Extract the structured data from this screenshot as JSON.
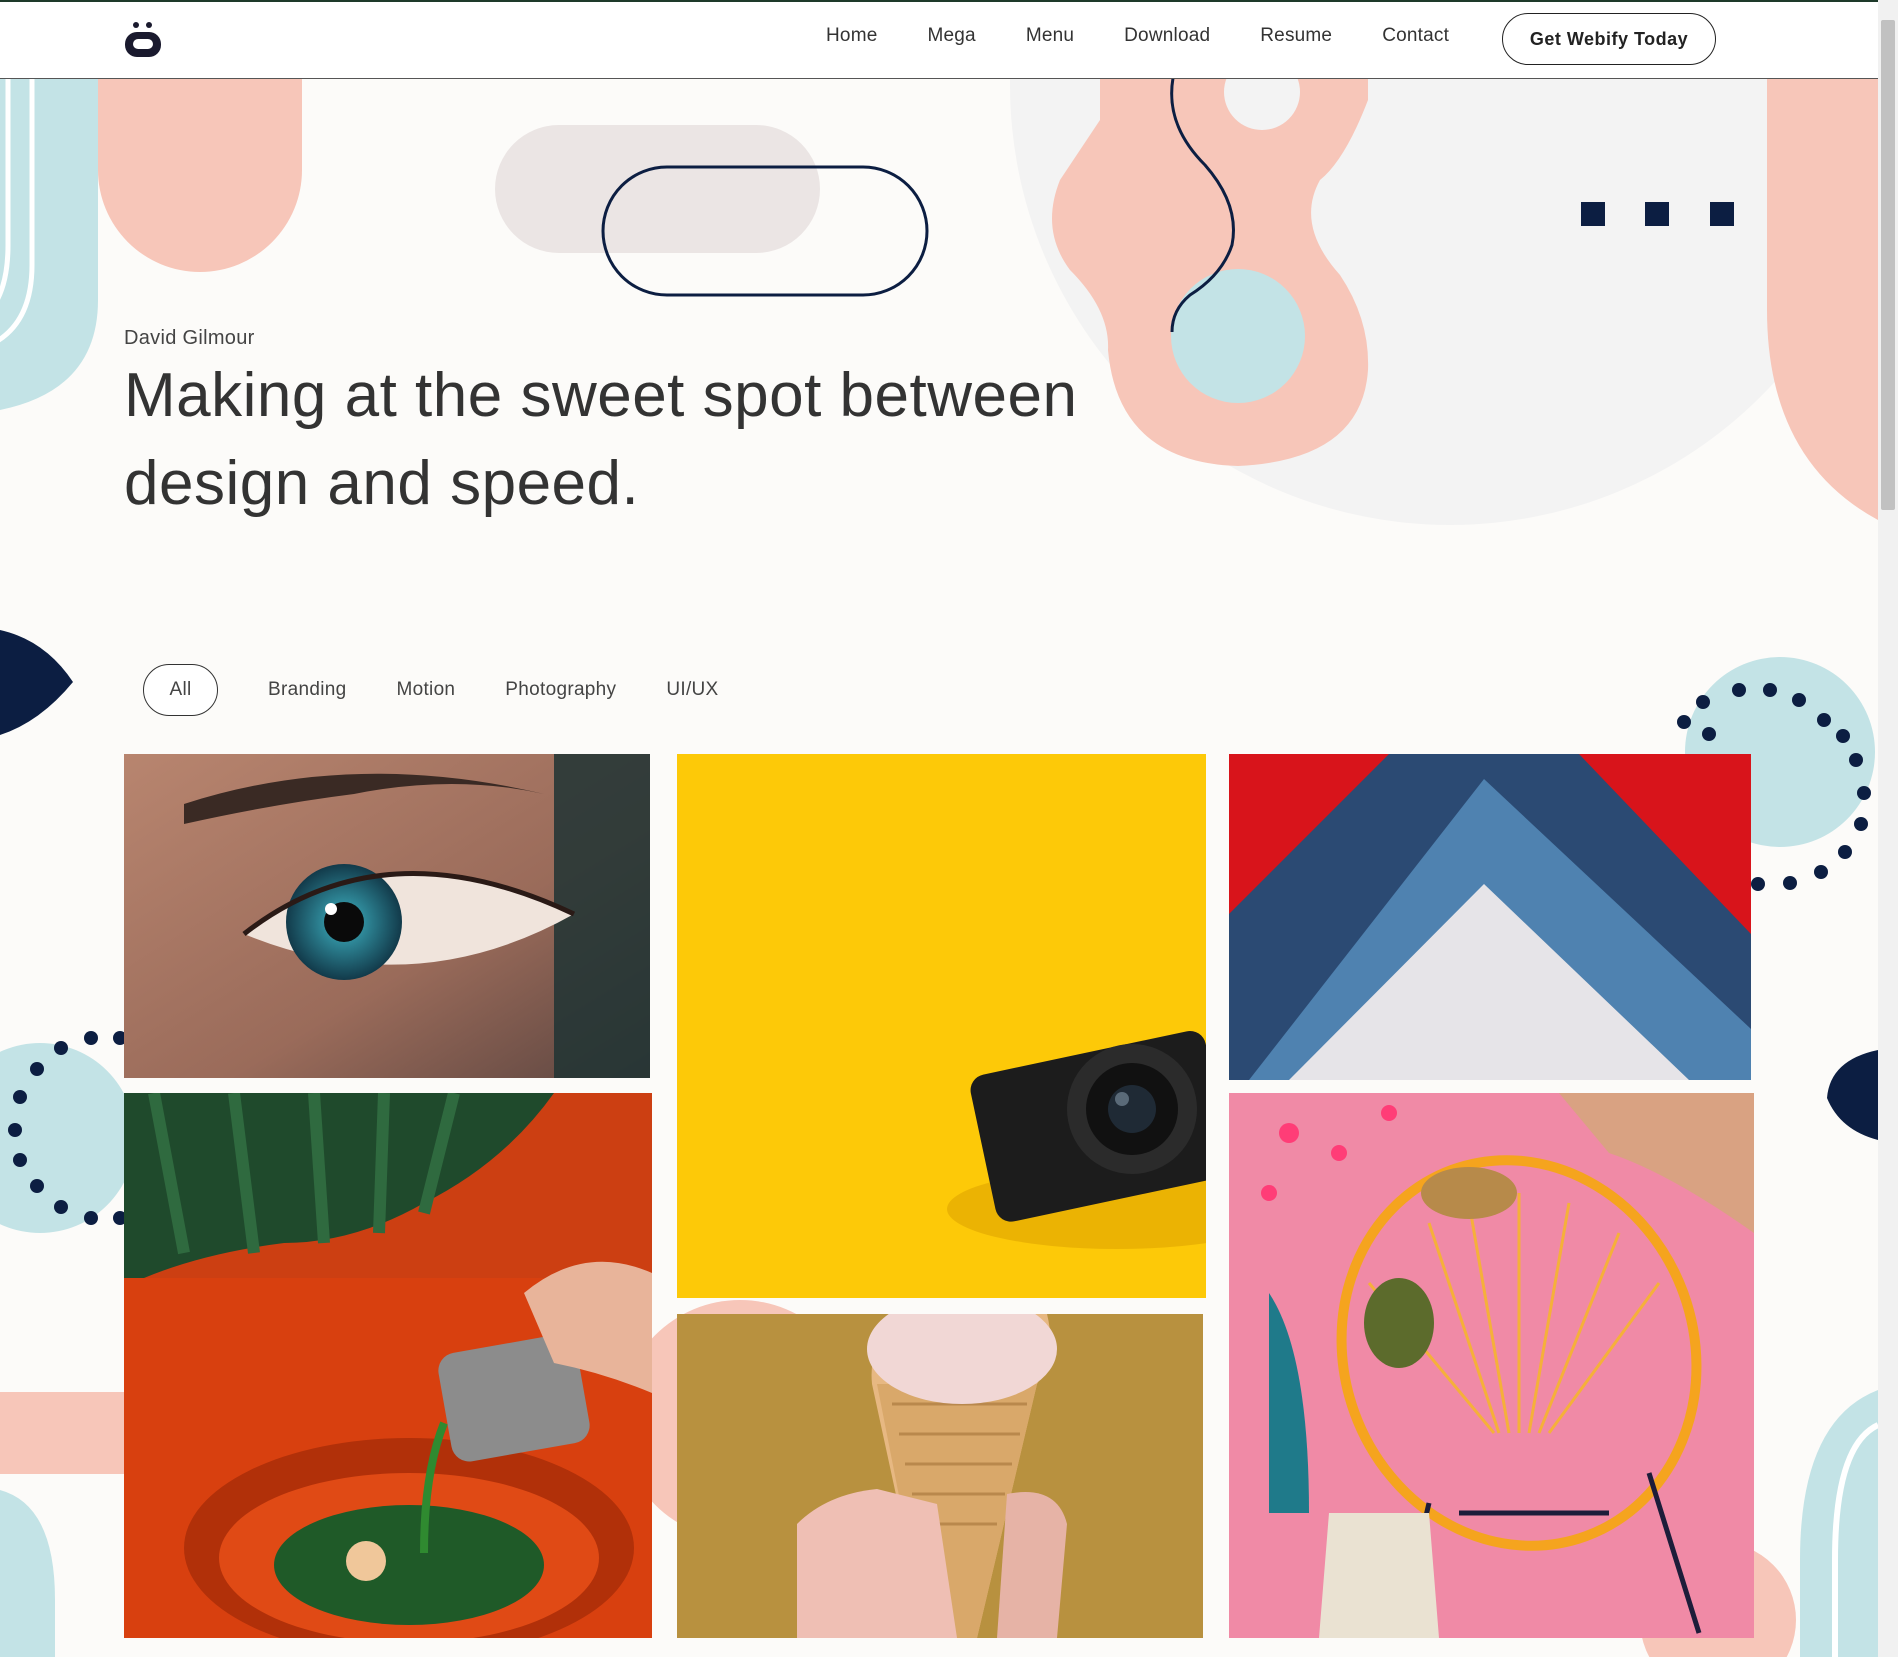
{
  "nav": {
    "logo_icon": "robot-face-icon",
    "links": [
      "Home",
      "Mega",
      "Menu",
      "Download",
      "Resume",
      "Contact"
    ],
    "cta_label": "Get Webify Today"
  },
  "hero": {
    "author": "David Gilmour",
    "headline": "Making at the sweet spot between design and speed."
  },
  "filters": {
    "items": [
      "All",
      "Branding",
      "Motion",
      "Photography",
      "UI/UX"
    ],
    "active": "All"
  },
  "gallery": {
    "tiles": [
      {
        "subject": "eye-closeup",
        "bg": "#8a6a5e"
      },
      {
        "subject": "camera-on-yellow",
        "bg": "#fdc908"
      },
      {
        "subject": "blue-paper-chevrons",
        "bg": "#2f5d8f"
      },
      {
        "subject": "pouring-green-sauce",
        "bg": "#d8400f"
      },
      {
        "subject": "ice-cream-cone",
        "bg": "#b8913f"
      },
      {
        "subject": "chair-on-pink",
        "bg": "#f08aa6"
      }
    ]
  },
  "colors": {
    "peach": "#f7c6b9",
    "light_blue": "#c3e3e6",
    "navy": "#0c1e42",
    "pale_grey": "#f3f3f3",
    "pill_grey": "#ebe5e4",
    "page_bg": "#fcfbf9"
  }
}
